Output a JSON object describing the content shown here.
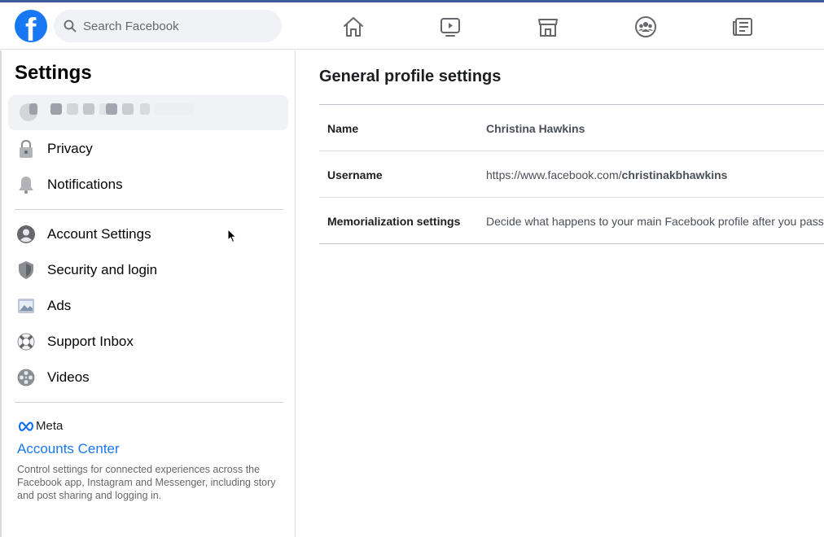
{
  "app": {
    "name": "Facebook"
  },
  "search": {
    "placeholder": "Search Facebook"
  },
  "nav": {
    "icons": [
      "home-icon",
      "watch-icon",
      "marketplace-icon",
      "groups-icon",
      "news-feed-icon"
    ]
  },
  "sidebar": {
    "title": "Settings",
    "top_items": [
      {
        "label": "Privacy",
        "icon": "lock-icon"
      },
      {
        "label": "Notifications",
        "icon": "bell-icon"
      }
    ],
    "items": [
      {
        "label": "Account Settings",
        "icon": "account-icon"
      },
      {
        "label": "Security and login",
        "icon": "shield-icon"
      },
      {
        "label": "Ads",
        "icon": "ads-icon"
      },
      {
        "label": "Support Inbox",
        "icon": "lifebuoy-icon"
      },
      {
        "label": "Videos",
        "icon": "film-reel-icon"
      }
    ],
    "meta_label": "Meta",
    "accounts_center": "Accounts Center",
    "accounts_center_desc": "Control settings for connected experiences across the Facebook app, Instagram and Messenger, including story and post sharing and logging in."
  },
  "main": {
    "title": "General profile settings",
    "rows": [
      {
        "key": "Name",
        "value": "Christina Hawkins"
      },
      {
        "key": "Username",
        "value_prefix": "https://www.facebook.com/",
        "value_bold": "christinakbhawkins"
      },
      {
        "key": "Memorialization settings",
        "value": "Decide what happens to your main Facebook profile after you pass away."
      }
    ]
  },
  "colors": {
    "brand": "#1877f2",
    "topline": "#3a5a98"
  }
}
